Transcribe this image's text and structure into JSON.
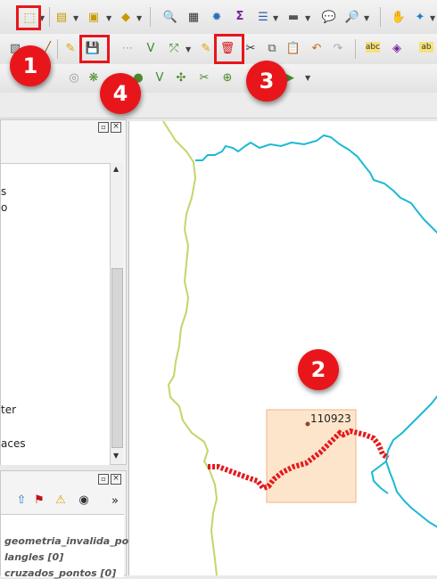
{
  "badges": {
    "b1": "1",
    "b2": "2",
    "b3": "3",
    "b4": "4"
  },
  "layers_panel": {
    "items": [
      "s",
      "o",
      "ter",
      "aces"
    ]
  },
  "bottom_panel": {
    "overflow": "»",
    "items": [
      "geometria_invalida_po",
      "langles [0]",
      "cruzados_pontos [0]"
    ]
  },
  "map": {
    "feature_label": "110923"
  },
  "colors": {
    "highlight": "#e8161b",
    "river": "#1cb9d4",
    "boundary": "#c3d66a",
    "selected_line": "#e31a1c",
    "selection_box": "#fde5cc"
  },
  "icons": [
    "select-feature-icon",
    "field-calculator-icon",
    "identify-icon",
    "pan-icon",
    "pencil-icon",
    "save-edits-icon",
    "delete-selected-icon",
    "cut-icon",
    "copy-icon",
    "paste-icon",
    "undo-icon",
    "redo-icon"
  ]
}
